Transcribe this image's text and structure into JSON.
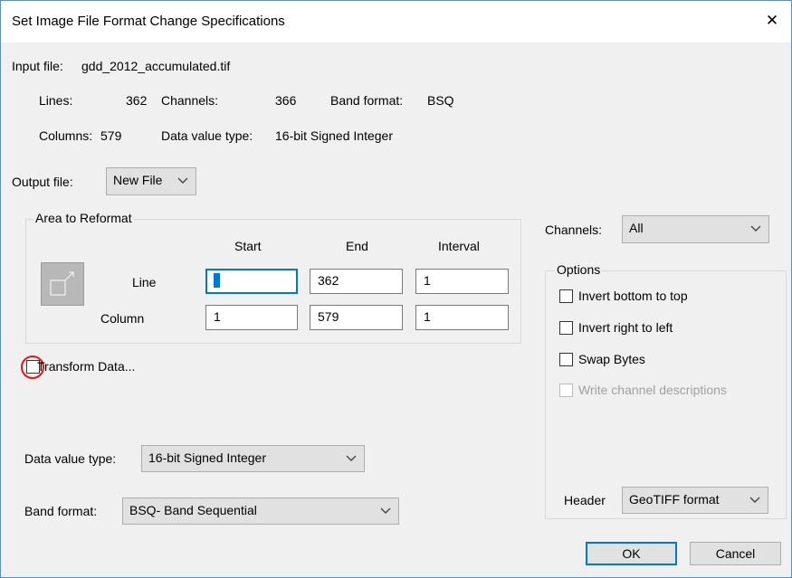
{
  "window": {
    "title": "Set Image File Format Change Specifications",
    "close_glyph": "✕"
  },
  "input_file": {
    "label": "Input file:",
    "value": "gdd_2012_accumulated.tif"
  },
  "info": {
    "lines_label": "Lines:",
    "lines_value": "362",
    "channels_label": "Channels:",
    "channels_value": "366",
    "band_format_label": "Band format:",
    "band_format_value": "BSQ",
    "columns_label": "Columns:",
    "columns_value": "579",
    "data_type_label": "Data value type:",
    "data_type_value": "16-bit Signed Integer"
  },
  "output_file": {
    "label": "Output file:",
    "selected": "New File"
  },
  "area": {
    "group_label": "Area to Reformat",
    "headers": {
      "start": "Start",
      "end": "End",
      "interval": "Interval"
    },
    "line": {
      "label": "Line",
      "start": "1",
      "end": "362",
      "interval": "1"
    },
    "column": {
      "label": "Column",
      "start": "1",
      "end": "579",
      "interval": "1"
    }
  },
  "transform": {
    "label": "Transform Data...",
    "checked": false
  },
  "data_value_type": {
    "label": "Data value type:",
    "selected": "16-bit Signed Integer"
  },
  "band_format": {
    "label": "Band format:",
    "selected": "BSQ- Band Sequential"
  },
  "channels": {
    "label": "Channels:",
    "selected": "All"
  },
  "options": {
    "group_label": "Options",
    "invert_bottom": "Invert bottom to top",
    "invert_right": "Invert right to left",
    "swap_bytes": "Swap Bytes",
    "write_channel_desc": "Write channel descriptions"
  },
  "header": {
    "label": "Header",
    "selected": "GeoTIFF format"
  },
  "buttons": {
    "ok": "OK",
    "cancel": "Cancel"
  },
  "colors": {
    "accent": "#0078d7",
    "highlight_ring": "#e0161a",
    "dialog_bg": "#f0f0f0"
  },
  "icons": {
    "close": "close-icon",
    "dropdown": "chevron-down-icon",
    "area_selector": "resize-area-icon"
  }
}
